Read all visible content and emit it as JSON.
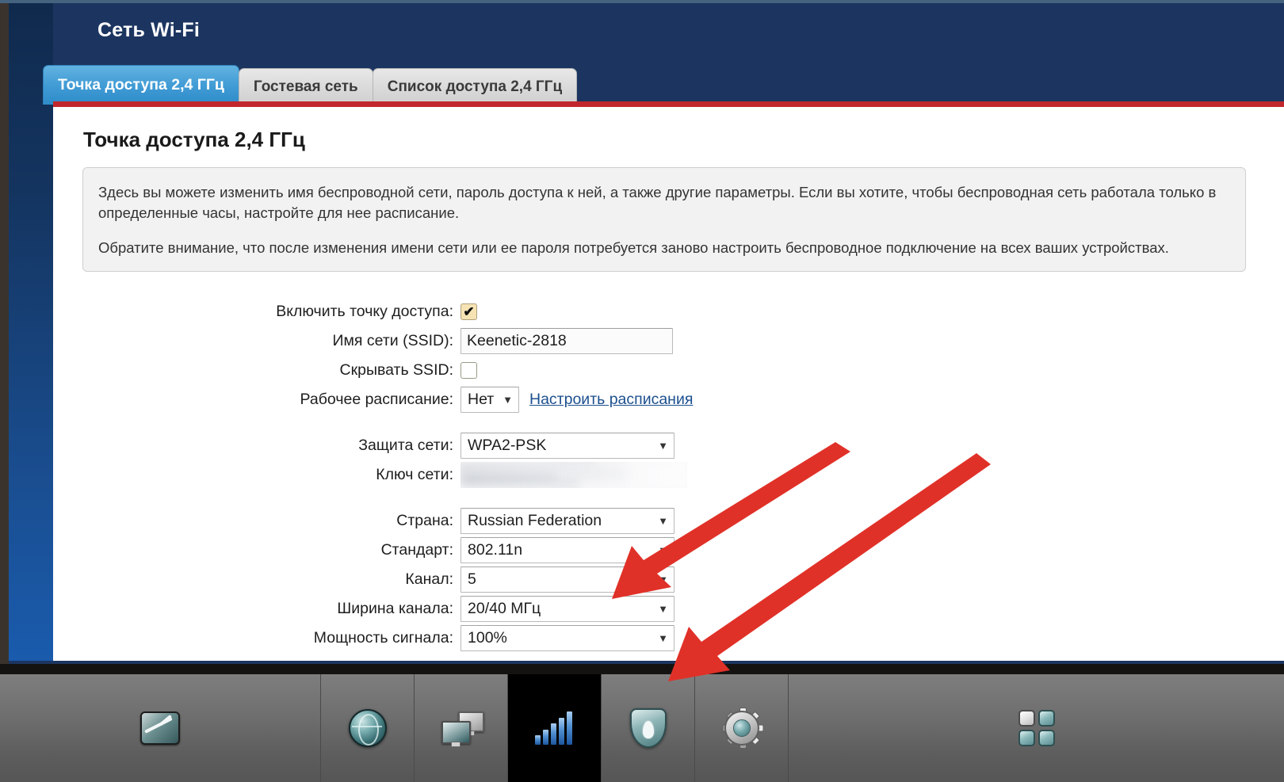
{
  "header": {
    "title": "Сеть Wi-Fi"
  },
  "tabs": [
    {
      "label": "Точка доступа 2,4 ГГц",
      "active": true
    },
    {
      "label": "Гостевая сеть",
      "active": false
    },
    {
      "label": "Список доступа 2,4 ГГц",
      "active": false
    }
  ],
  "page": {
    "heading": "Точка доступа 2,4 ГГц",
    "info_paragraph_1": "Здесь вы можете изменить имя беспроводной сети, пароль доступа к ней, а также другие параметры. Если вы хотите, чтобы беспроводная сеть работала только в определенные часы, настройте для нее расписание.",
    "info_paragraph_2": "Обратите внимание, что после изменения имени сети или ее пароля потребуется заново настроить беспроводное подключение на всех ваших устройствах."
  },
  "form": {
    "enable_ap_label": "Включить точку доступа:",
    "enable_ap_checked": true,
    "ssid_label": "Имя сети (SSID):",
    "ssid_value": "Keenetic-2818",
    "hide_ssid_label": "Скрывать SSID:",
    "hide_ssid_checked": false,
    "schedule_label": "Рабочее расписание:",
    "schedule_value": "Нет",
    "schedule_link": "Настроить расписания",
    "security_label": "Защита сети:",
    "security_value": "WPA2-PSK",
    "key_label": "Ключ сети:",
    "key_value": "",
    "country_label": "Страна:",
    "country_value": "Russian Federation",
    "standard_label": "Стандарт:",
    "standard_value": "802.11n",
    "channel_label": "Канал:",
    "channel_value": "5",
    "channel_width_label": "Ширина канала:",
    "channel_width_value": "20/40 МГц",
    "power_label": "Мощность сигнала:",
    "power_value": "100%",
    "caret_glyph": "▼",
    "check_glyph": "✔"
  },
  "appbar": {
    "items": [
      {
        "icon": "chart-icon",
        "selected": false
      },
      {
        "icon": "globe-icon",
        "selected": false
      },
      {
        "icon": "monitors-icon",
        "selected": false
      },
      {
        "icon": "signal-bars-icon",
        "selected": true
      },
      {
        "icon": "firewall-shield-icon",
        "selected": false
      },
      {
        "icon": "gear-icon",
        "selected": false
      },
      {
        "icon": "apps-tiles-icon",
        "selected": false
      }
    ]
  },
  "annotations": {
    "arrow_color": "#e03128",
    "arrow_1_target": "channel-select",
    "arrow_2_target": "appbar-item-signal-bars"
  },
  "colors": {
    "header_blue": "#1c3560",
    "accent_red": "#c1272d",
    "tab_active_blue": "#3f9ad4",
    "link_blue": "#1c4f8f"
  }
}
